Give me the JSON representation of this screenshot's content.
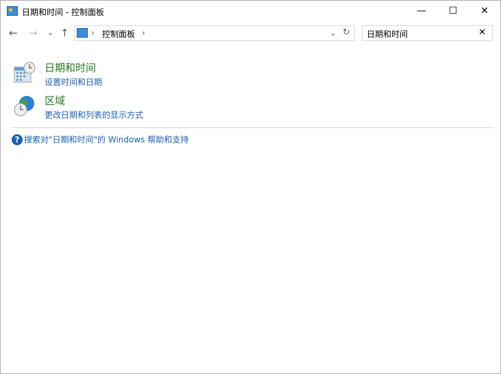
{
  "window": {
    "title": "日期和时间 - 控制面板",
    "minimize": "—",
    "maximize": "☐",
    "close": "✕"
  },
  "nav": {
    "back": "←",
    "forward": "→",
    "recent": "⌄",
    "up": "↑",
    "refresh": "↻",
    "dropdown": "⌄"
  },
  "address": {
    "separator": "›",
    "crumb": "控制面板",
    "trail": "›"
  },
  "search": {
    "value": "日期和时间",
    "clear": "✕"
  },
  "results": [
    {
      "title": "日期和时间",
      "subtitle": "设置时间和日期",
      "icon": "calendar-clock-icon"
    },
    {
      "title": "区域",
      "subtitle": "更改日期和列表的显示方式",
      "icon": "globe-clock-icon"
    }
  ],
  "help": {
    "icon": "?",
    "text": "搜索对\"日期和时间\"的 Windows 帮助和支持"
  }
}
